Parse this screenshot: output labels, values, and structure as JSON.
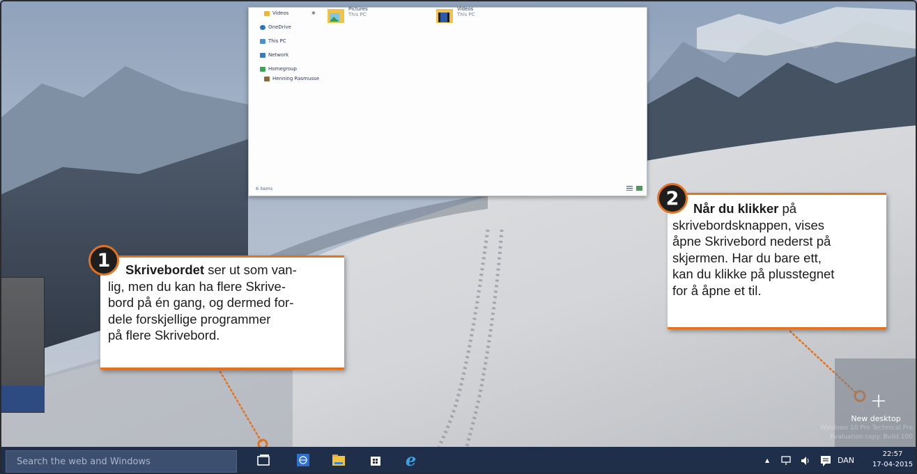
{
  "explorer": {
    "nav_items": [
      {
        "label": "Videos",
        "icon": "video-folder-icon"
      },
      {
        "label": "OneDrive",
        "icon": "onedrive-icon"
      },
      {
        "label": "This PC",
        "icon": "pc-icon"
      },
      {
        "label": "Network",
        "icon": "network-icon"
      },
      {
        "label": "Homegroup",
        "icon": "homegroup-icon"
      },
      {
        "label": "Henning Rasmusse",
        "icon": "user-icon"
      }
    ],
    "pin_glyph": "✱",
    "tiles": [
      {
        "title": "Pictures",
        "subtitle": "This PC",
        "icon": "pictures-folder-icon"
      },
      {
        "title": "Videos",
        "subtitle": "This PC",
        "icon": "videos-folder-icon"
      }
    ],
    "status_text": "6 items"
  },
  "callout1": {
    "number": "1",
    "bold": "Skrivebordet",
    "line1": " ser ut som van-",
    "lines": [
      "lig, men du kan ha flere Skrive-",
      "bord på én gang, og dermed for-",
      "dele forskjellige programmer",
      "på flere Skrivebord."
    ]
  },
  "callout2": {
    "number": "2",
    "bold": "Når du klikker",
    "line1": " på",
    "lines": [
      "skrivebordsknappen, vises",
      "åpne Skrivebord nederst på",
      "skjermen. Har du bare ett,",
      "kan du klikke på plusstegnet",
      "for å åpne et til."
    ]
  },
  "new_desktop": {
    "label": "New desktop",
    "icon": "plus-icon"
  },
  "watermark": {
    "line1": "Windows 10 Pro Technical Pre",
    "line2": "Evaluation copy. Build 100"
  },
  "taskbar": {
    "search_placeholder": "Search the web and Windows",
    "icons": [
      "task-view-icon",
      "globe-icon",
      "file-explorer-icon",
      "store-icon",
      "internet-explorer-icon"
    ],
    "tray_arrow": "▲",
    "language": "DAN",
    "time": "22:57",
    "date": "17-04-2015"
  },
  "colors": {
    "accent": "#e4711c",
    "taskbar": "#1f2f4a",
    "callout_text": "#1b1b1b"
  }
}
